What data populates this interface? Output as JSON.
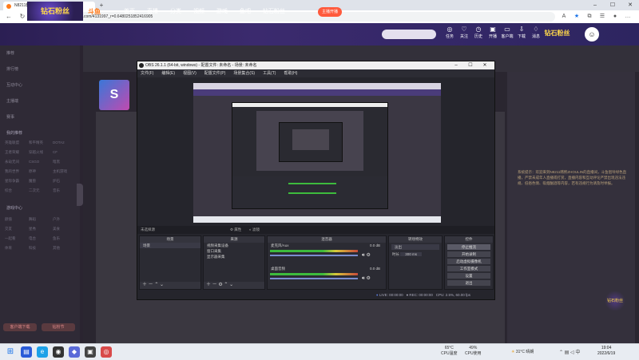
{
  "browser": {
    "tab_title": "N8211韩熙ZHOULIN计是播_斗鱼",
    "url": "https://www.douyu.com/4131997_r=0.6480251852416905"
  },
  "site": {
    "logo_text": "钻石粉丝",
    "brand": "斗鱼",
    "nav": [
      "首页",
      "直播",
      "分类",
      "视频",
      "游戏",
      "鱼吧",
      "钻石粉丝"
    ],
    "header_button": "主播开播",
    "header_icons": [
      "任务",
      "关注",
      "历史",
      "开播",
      "客户端",
      "下载",
      "消息"
    ],
    "header_logo2": "钻石粉丝"
  },
  "sidebar": {
    "items": [
      "推荐",
      "排行榜",
      "互动中心",
      "主播端",
      "赛事"
    ],
    "section1": "我的推荐",
    "grid1": [
      "英雄联盟",
      "和平精英",
      "DOTA2",
      "王者荣耀",
      "穿越火线",
      "CF",
      "永劫无间",
      "CSGO",
      "暗黑",
      "我的世界",
      "原神",
      "主机游戏",
      "星际争霸",
      "魔兽",
      "炉石",
      "综合",
      "二次元",
      "音乐"
    ],
    "section2": "游戏中心",
    "grid2": [
      "颜值",
      "舞蹈",
      "户外",
      "交友",
      "星秀",
      "美食",
      "一起看",
      "电台",
      "鱼乐",
      "体育",
      "科技",
      "其他"
    ],
    "bottom_buttons": [
      "客户端下载",
      "钻粉节"
    ]
  },
  "page": {
    "streamer_initial": "S",
    "chat_text": "系统提示：欢迎来到N8211韩熙ZHOULIN的直播间，斗鱼倡导绿色直播，严禁未成年人直播或打赏，直播内容和互动评论严禁出现违法违规、低俗色情、吸烟酗酒等内容，若有违规行为请及时举报。",
    "side_badge": "钻石粉丝"
  },
  "obs": {
    "title": "OBS 26.1.1 (64-bit, windows) - 配置文件: 未命名 - 场景: 未命名",
    "menu": [
      "文件(F)",
      "编辑(E)",
      "视图(V)",
      "配置文件(P)",
      "场景集合(S)",
      "工具(T)",
      "帮助(H)"
    ],
    "scene_label": "未选择源",
    "props_button": "属性",
    "filter_button": "滤镜",
    "docks": {
      "scenes": {
        "title": "场景",
        "items": [
          "场景"
        ]
      },
      "sources": {
        "title": "来源",
        "items": [
          "视频采集设备",
          "窗口采集",
          "显示器采集"
        ]
      },
      "mixer": {
        "title": "混音器",
        "channels": [
          {
            "name": "麦克风/Aux",
            "db": "0.0 dB"
          },
          {
            "name": "桌面音频",
            "db": "0.0 dB"
          }
        ]
      },
      "transitions": {
        "title": "转场特效",
        "type": "淡出",
        "duration_label": "时长",
        "duration": "300 ms"
      },
      "controls": {
        "title": "控件",
        "buttons": [
          "停止推流",
          "开始录制",
          "启动虚拟摄像机",
          "工作室模式",
          "设置",
          "退出"
        ]
      }
    },
    "status": {
      "live": "LIVE: 00:00:00",
      "rec": "REC: 00:00:00",
      "cpu": "CPU: 2.5%, 60.00 fps"
    }
  },
  "taskbar": {
    "cpu_temp": "65°C",
    "cpu_temp_label": "CPU温度",
    "cpu_use": "49%",
    "cpu_use_label": "CPU使用",
    "weather": "31°C 晴朗",
    "time": "19:04",
    "date": "2022/6/19"
  }
}
